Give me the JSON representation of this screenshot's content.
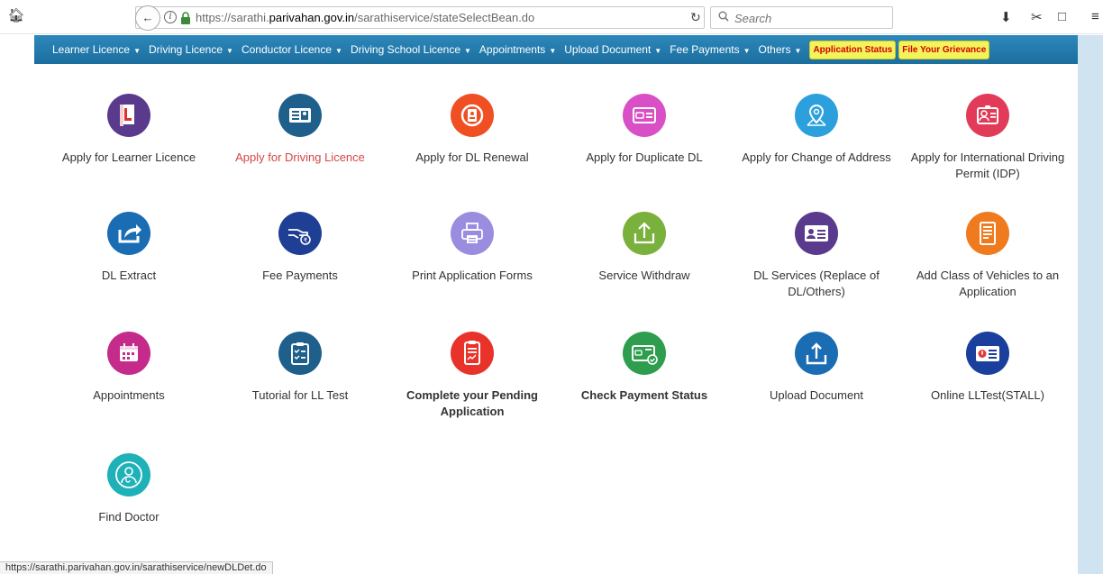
{
  "browser": {
    "home_icon": "home-icon",
    "url_prefix": "https://sarathi.",
    "url_domain": "parivahan.gov.in",
    "url_path": "/sarathiservice/stateSelectBean.do",
    "search_placeholder": "Search",
    "status_url": "https://sarathi.parivahan.gov.in/sarathiservice/newDLDet.do"
  },
  "nav": {
    "items": [
      {
        "label": "Learner Licence"
      },
      {
        "label": "Driving Licence"
      },
      {
        "label": "Conductor Licence"
      },
      {
        "label": "Driving School Licence"
      },
      {
        "label": "Appointments"
      },
      {
        "label": "Upload Document"
      },
      {
        "label": "Fee Payments"
      },
      {
        "label": "Others"
      }
    ],
    "badges": [
      {
        "label": "Application Status"
      },
      {
        "label": "File Your Grievance"
      }
    ]
  },
  "services": [
    {
      "label": "Apply for Learner Licence",
      "icon": "learner-l-icon",
      "color": "#5a3a8c"
    },
    {
      "label": "Apply for Driving Licence",
      "icon": "licence-card-icon",
      "color": "#1f5f8b",
      "highlight": true
    },
    {
      "label": "Apply for DL Renewal",
      "icon": "renewal-icon",
      "color": "#f04e23"
    },
    {
      "label": "Apply for Duplicate DL",
      "icon": "duplicate-card-icon",
      "color": "#d94fc5"
    },
    {
      "label": "Apply for Change of Address",
      "icon": "location-pin-icon",
      "color": "#2ba0dd"
    },
    {
      "label": "Apply for International Driving Permit (IDP)",
      "icon": "id-badge-icon",
      "color": "#e23b5a"
    },
    {
      "label": "DL Extract",
      "icon": "share-icon",
      "color": "#1a6cb3"
    },
    {
      "label": "Fee Payments",
      "icon": "hand-payment-icon",
      "color": "#1f3f94"
    },
    {
      "label": "Print Application Forms",
      "icon": "printer-icon",
      "color": "#9a8de0"
    },
    {
      "label": "Service Withdraw",
      "icon": "upload-box-icon",
      "color": "#7ab03c"
    },
    {
      "label": "DL Services (Replace of DL/Others)",
      "icon": "contact-card-icon",
      "color": "#5a3a8c"
    },
    {
      "label": "Add Class of Vehicles to an Application",
      "icon": "document-list-icon",
      "color": "#f07a1e"
    },
    {
      "label": "Appointments",
      "icon": "calendar-icon",
      "color": "#c42b8a"
    },
    {
      "label": "Tutorial for LL Test",
      "icon": "checklist-icon",
      "color": "#1f5f8b"
    },
    {
      "label": "Complete your Pending Application",
      "icon": "pending-document-icon",
      "color": "#e8322a",
      "bold": true
    },
    {
      "label": "Check Payment Status",
      "icon": "payment-card-check-icon",
      "color": "#2e9e4e",
      "bold": true
    },
    {
      "label": "Upload Document",
      "icon": "upload-tray-icon",
      "color": "#1a6cb3"
    },
    {
      "label": "Online LLTest(STALL)",
      "icon": "online-test-icon",
      "color": "#1a3f9c"
    },
    {
      "label": "Find Doctor",
      "icon": "doctor-icon",
      "color": "#1fb1b8"
    }
  ]
}
